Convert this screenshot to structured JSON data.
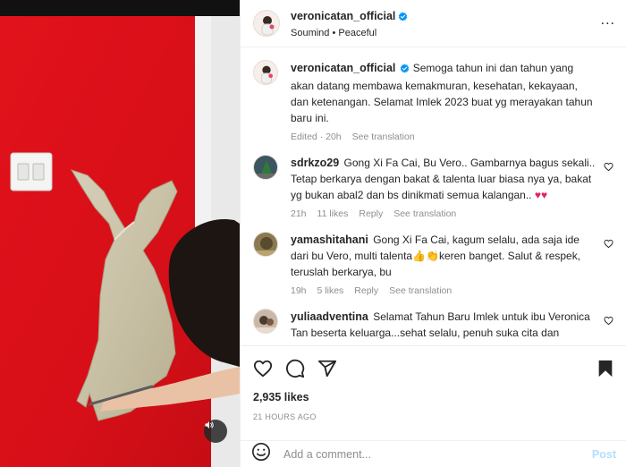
{
  "media": {
    "mute_icon": "speaker-icon"
  },
  "header": {
    "username": "veronicatan_official",
    "audio": "Soumind • Peaceful",
    "more_icon": "more-icon",
    "more_label": "..."
  },
  "caption": {
    "username": "veronicatan_official",
    "text": "Semoga tahun ini dan tahun yang akan datang membawa kemakmuran, kesehatan, kekayaan, dan ketenangan. Selamat Imlek 2023 buat yg merayakan tahun baru ini.",
    "edited": "Edited · 20h",
    "see_translation": "See translation"
  },
  "comments": [
    {
      "username": "sdrkzo29",
      "text": "Gong Xi Fa Cai, Bu Vero.. Gambarnya bagus sekali.. Tetap berkarya dengan bakat & talenta luar biasa nya ya, bakat yg bukan abal2 dan bs dinikmati semua kalangan..",
      "emoji": "♥♥",
      "time": "21h",
      "likes": "11 likes",
      "reply": "Reply",
      "see_translation": "See translation"
    },
    {
      "username": "yamashitahani",
      "text": "Gong Xi Fa Cai, kagum selalu, ada saja ide dari bu Vero, multi talenta👍👏keren banget. Salut & respek, teruslah berkarya, bu",
      "time": "19h",
      "likes": "5 likes",
      "reply": "Reply",
      "see_translation": "See translation"
    },
    {
      "username": "yuliaadventina",
      "text": "Selamat Tahun Baru Imlek untuk ibu Veronica Tan beserta keluarga...sehat selalu, penuh suka cita dan",
      "time": "",
      "likes": "",
      "reply": "",
      "see_translation": ""
    }
  ],
  "actions": {
    "like_icon": "heart-icon",
    "comment_icon": "comment-icon",
    "share_icon": "share-icon",
    "save_icon": "bookmark-icon"
  },
  "likes": "2,935 likes",
  "timestamp": "21 HOURS AGO",
  "add_comment": {
    "placeholder": "Add a comment...",
    "post_label": "Post"
  },
  "colors": {
    "accent": "#0095f6",
    "post_disabled": "#b2dffc",
    "wall_red": "#e0141c",
    "heart_red": "#ed4956"
  }
}
